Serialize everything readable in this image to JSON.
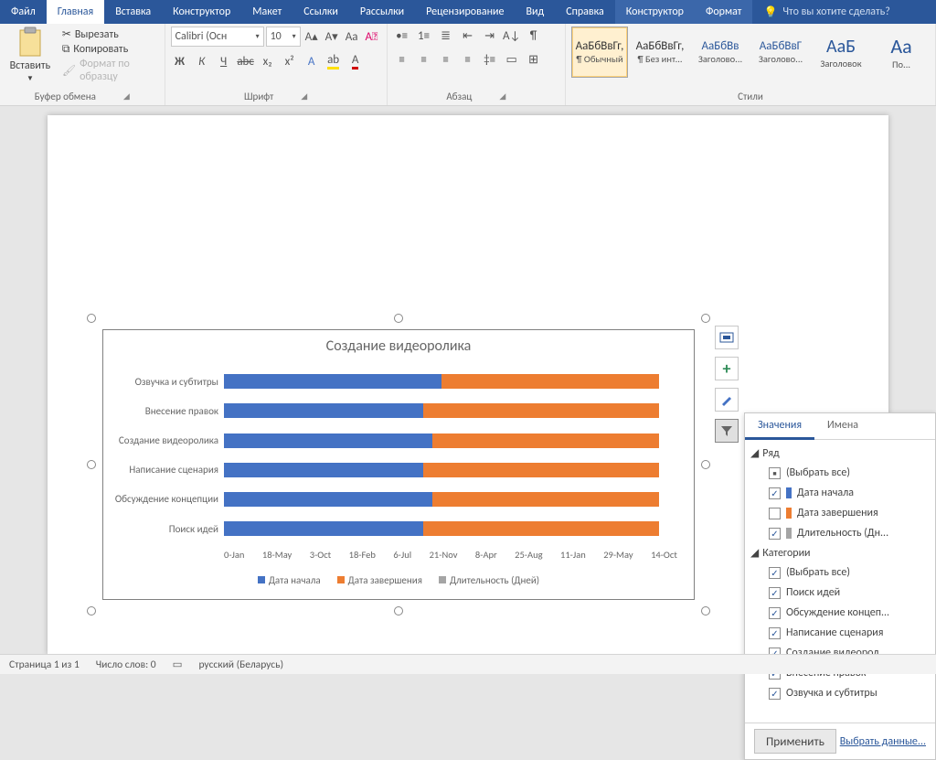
{
  "tabs": {
    "file": "Файл",
    "home": "Главная",
    "insert": "Вставка",
    "design": "Конструктор",
    "layout": "Макет",
    "references": "Ссылки",
    "mailings": "Рассылки",
    "review": "Рецензирование",
    "view": "Вид",
    "help": "Справка",
    "chart_design": "Конструктор",
    "format": "Формат",
    "tell_me": "Что вы хотите сделать?"
  },
  "ribbon": {
    "paste": "Вставить",
    "cut": "Вырезать",
    "copy": "Копировать",
    "format_painter": "Формат по образцу",
    "clipboard": "Буфер обмена",
    "font_name": "Calibri (Осн",
    "font_size": "10",
    "font": "Шрифт",
    "paragraph": "Абзац",
    "styles_label": "Стили",
    "styles": [
      {
        "sample": "АаБбВвГг,",
        "name": "¶ Обычный"
      },
      {
        "sample": "АаБбВвГг,",
        "name": "¶ Без инт..."
      },
      {
        "sample": "АаБбВв",
        "name": "Заголово..."
      },
      {
        "sample": "АаБбВвГ",
        "name": "Заголово..."
      },
      {
        "sample": "АаБ",
        "name": "Заголовок"
      },
      {
        "sample": "Аа",
        "name": "По..."
      }
    ]
  },
  "chart_data": {
    "type": "bar",
    "title": "Создание видеоролика",
    "categories": [
      "Озвучка и субтитры",
      "Внесение правок",
      "Создание видеоролика",
      "Написание сценария",
      "Обсуждение концепции",
      "Поиск идей"
    ],
    "series": [
      {
        "name": "Дата начала",
        "values": [
          0.48,
          0.44,
          0.46,
          0.44,
          0.46,
          0.44
        ]
      },
      {
        "name": "Дата завершения",
        "values": [
          0.48,
          0.52,
          0.5,
          0.52,
          0.5,
          0.52
        ]
      },
      {
        "name": "Длительность (Дней)",
        "values": [
          0,
          0,
          0,
          0,
          0,
          0
        ]
      }
    ],
    "x_ticks": [
      "0-Jan",
      "18-May",
      "3-Oct",
      "18-Feb",
      "6-Jul",
      "21-Nov",
      "8-Apr",
      "25-Aug",
      "11-Jan",
      "29-May",
      "14-Oct"
    ],
    "legend": [
      "Дата начала",
      "Дата завершения",
      "Длительность (Дней)"
    ]
  },
  "side_buttons": {
    "layout": "layout",
    "add": "add",
    "brush": "brush",
    "filter": "filter"
  },
  "filter_pane": {
    "tab_values": "Значения",
    "tab_names": "Имена",
    "series_hdr": "Ряд",
    "series_items": [
      {
        "label": "(Выбрать все)",
        "state": "mixed",
        "swatch": null
      },
      {
        "label": "Дата начала",
        "state": "checked",
        "swatch": "#4472c4"
      },
      {
        "label": "Дата завершения",
        "state": "unchecked",
        "swatch": "#ed7d31"
      },
      {
        "label": "Длительность (Дн...",
        "state": "checked",
        "swatch": "#a5a5a5"
      }
    ],
    "cat_hdr": "Категории",
    "cat_items": [
      {
        "label": "(Выбрать все)",
        "state": "checked"
      },
      {
        "label": "Поиск идей",
        "state": "checked"
      },
      {
        "label": "Обсуждение концеп...",
        "state": "checked"
      },
      {
        "label": "Написание сценария",
        "state": "checked"
      },
      {
        "label": "Создание видеорол...",
        "state": "checked"
      },
      {
        "label": "Внесение правок",
        "state": "checked"
      },
      {
        "label": "Озвучка и субтитры",
        "state": "checked"
      }
    ],
    "apply": "Применить",
    "select_data": "Выбрать данные..."
  },
  "status": {
    "page": "Страница 1 из 1",
    "words": "Число слов: 0",
    "lang": "русский (Беларусь)"
  }
}
